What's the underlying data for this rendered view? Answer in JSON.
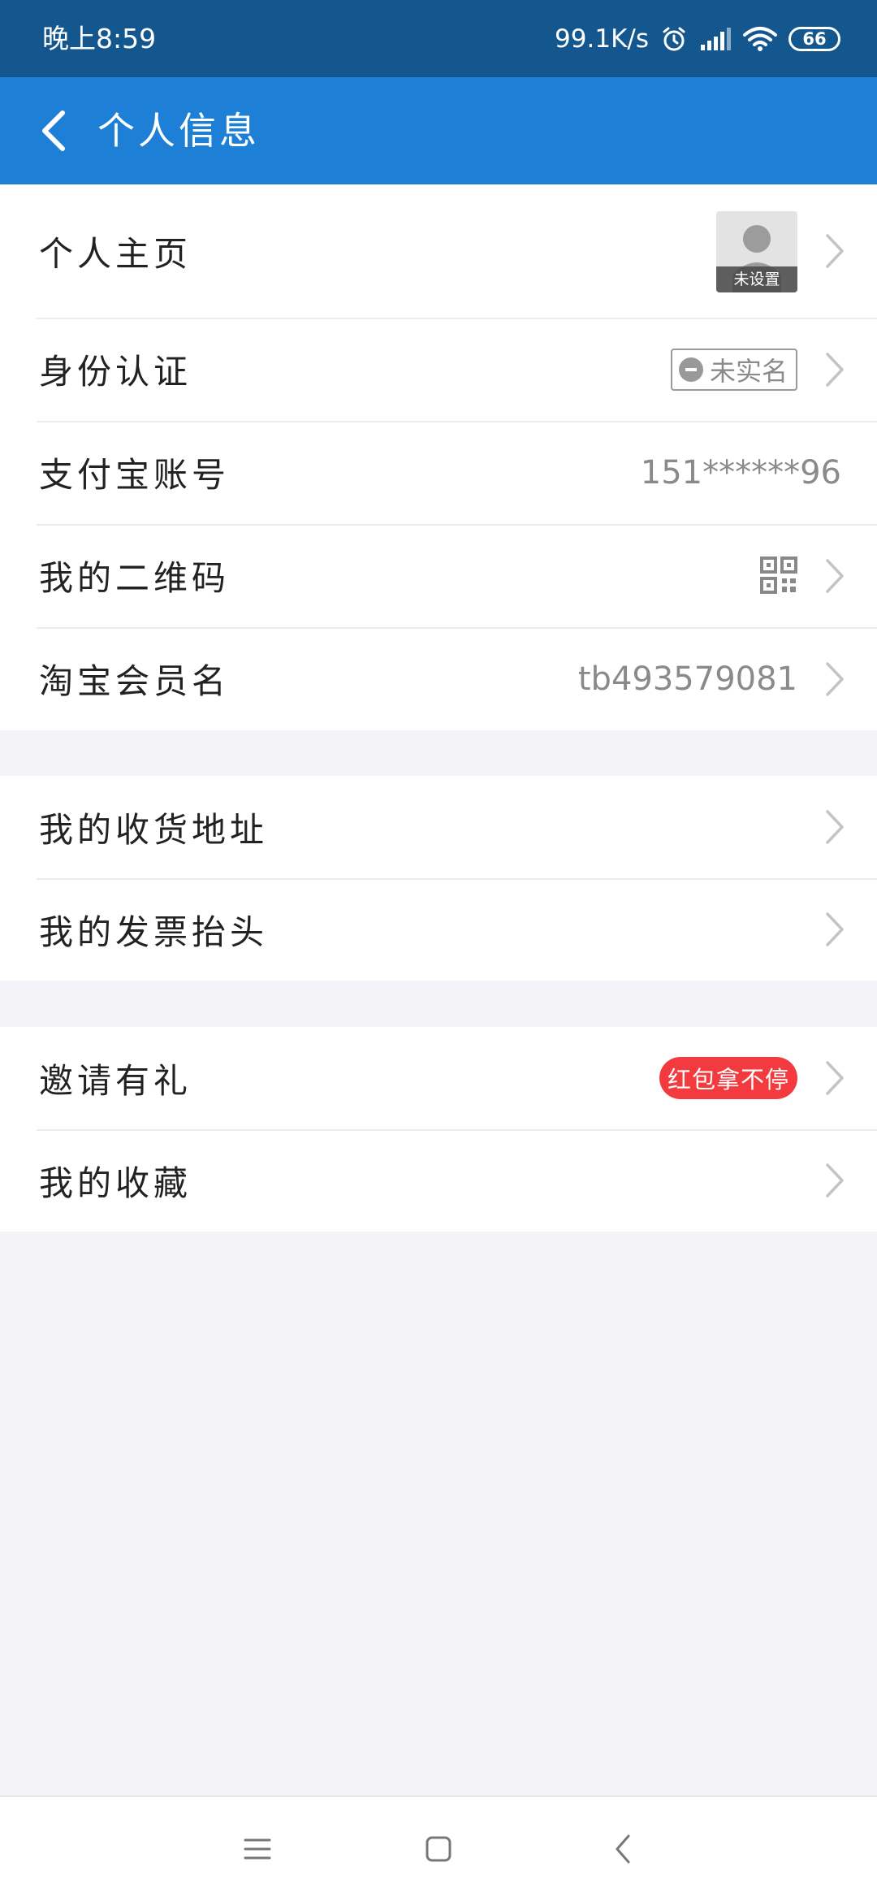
{
  "status_bar": {
    "time": "晚上8:59",
    "net_speed": "99.1K/s",
    "battery": "66"
  },
  "header": {
    "title": "个人信息"
  },
  "sections": [
    {
      "rows": [
        {
          "label": "个人主页",
          "avatar_caption": "未设置"
        },
        {
          "label": "身份认证",
          "badge": "未实名"
        },
        {
          "label": "支付宝账号",
          "value": "151******96"
        },
        {
          "label": "我的二维码"
        },
        {
          "label": "淘宝会员名",
          "value": "tb493579081"
        }
      ]
    },
    {
      "rows": [
        {
          "label": "我的收货地址"
        },
        {
          "label": "我的发票抬头"
        }
      ]
    },
    {
      "rows": [
        {
          "label": "邀请有礼",
          "promo": "红包拿不停"
        },
        {
          "label": "我的收藏"
        }
      ]
    }
  ],
  "icons": {
    "back": "back-arrow-icon",
    "chevron": "chevron-right-icon",
    "qr": "qr-code-icon",
    "alarm": "alarm-icon",
    "signal": "signal-icon",
    "wifi": "wifi-icon"
  },
  "colors": {
    "status_bar": "#13578e",
    "header": "#1d80d6",
    "promo": "#f23a3f",
    "page_bg": "#f3f3f8"
  }
}
